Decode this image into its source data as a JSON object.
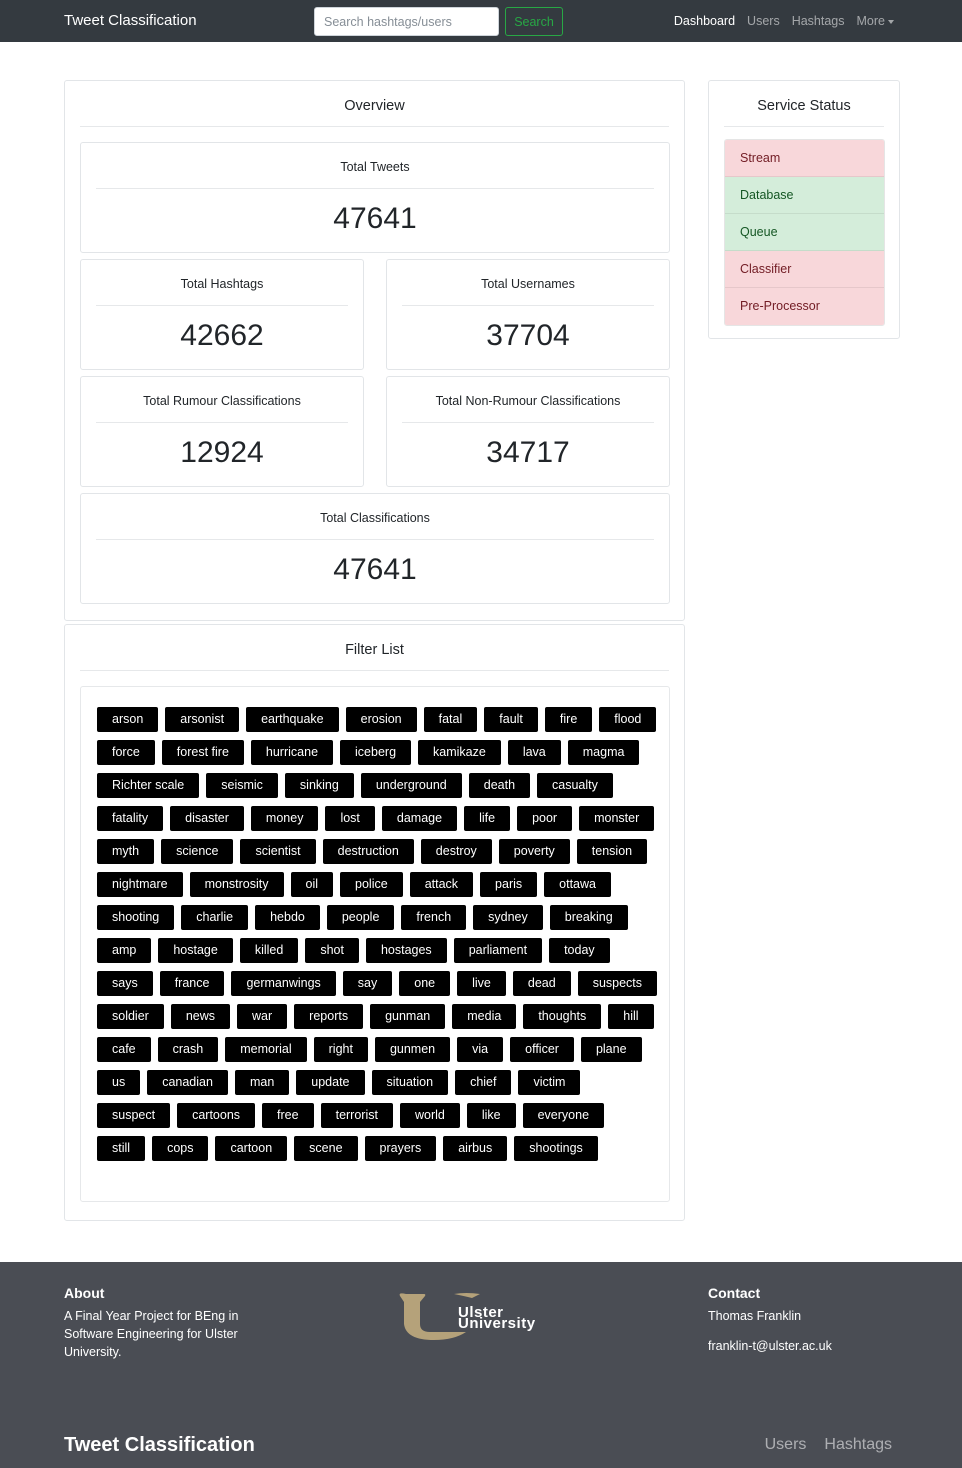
{
  "nav": {
    "brand": "Tweet Classification",
    "search_placeholder": "Search hashtags/users",
    "search_button": "Search",
    "links": [
      "Dashboard",
      "Users",
      "Hashtags",
      "More"
    ]
  },
  "overview": {
    "title": "Overview",
    "total_tweets": {
      "label": "Total Tweets",
      "value": "47641"
    },
    "total_hashtags": {
      "label": "Total Hashtags",
      "value": "42662"
    },
    "total_usernames": {
      "label": "Total Usernames",
      "value": "37704"
    },
    "total_rumour": {
      "label": "Total Rumour Classifications",
      "value": "12924"
    },
    "total_non_rumour": {
      "label": "Total Non-Rumour Classifications",
      "value": "34717"
    },
    "total_classifications": {
      "label": "Total Classifications",
      "value": "47641"
    }
  },
  "service_status": {
    "title": "Service Status",
    "items": [
      {
        "label": "Stream",
        "status": "down"
      },
      {
        "label": "Database",
        "status": "up"
      },
      {
        "label": "Queue",
        "status": "up"
      },
      {
        "label": "Classifier",
        "status": "down"
      },
      {
        "label": "Pre-Processor",
        "status": "down"
      }
    ],
    "colors": {
      "up": "#d4edda",
      "down": "#f8d7da"
    }
  },
  "filter_list": {
    "title": "Filter List",
    "tags": [
      "arson",
      "arsonist",
      "earthquake",
      "erosion",
      "fatal",
      "fault",
      "fire",
      "flood",
      "force",
      "forest fire",
      "hurricane",
      "iceberg",
      "kamikaze",
      "lava",
      "magma",
      "Richter scale",
      "seismic",
      "sinking",
      "underground",
      "death",
      "casualty",
      "fatality",
      "disaster",
      "money",
      "lost",
      "damage",
      "life",
      "poor",
      "monster",
      "myth",
      "science",
      "scientist",
      "destruction",
      "destroy",
      "poverty",
      "tension",
      "nightmare",
      "monstrosity",
      "oil",
      "police",
      "attack",
      "paris",
      "ottawa",
      "shooting",
      "charlie",
      "hebdo",
      "people",
      "french",
      "sydney",
      "breaking",
      "amp",
      "hostage",
      "killed",
      "shot",
      "hostages",
      "parliament",
      "today",
      "says",
      "france",
      "germanwings",
      "say",
      "one",
      "live",
      "dead",
      "suspects",
      "soldier",
      "news",
      "war",
      "reports",
      "gunman",
      "media",
      "thoughts",
      "hill",
      "cafe",
      "crash",
      "memorial",
      "right",
      "gunmen",
      "via",
      "officer",
      "plane",
      "us",
      "canadian",
      "man",
      "update",
      "situation",
      "chief",
      "victim",
      "suspect",
      "cartoons",
      "free",
      "terrorist",
      "world",
      "like",
      "everyone",
      "still",
      "cops",
      "cartoon",
      "scene",
      "prayers",
      "airbus",
      "shootings"
    ]
  },
  "footer": {
    "about_title": "About",
    "about_text": "A Final Year Project for BEng in Software Engineering for Ulster University.",
    "logo_text_1": "Ulster",
    "logo_text_2": "University",
    "contact_title": "Contact",
    "contact_name": "Thomas Franklin",
    "contact_email": "franklin-t@ulster.ac.uk",
    "brand": "Tweet Classification",
    "links": [
      "Users",
      "Hashtags"
    ]
  }
}
